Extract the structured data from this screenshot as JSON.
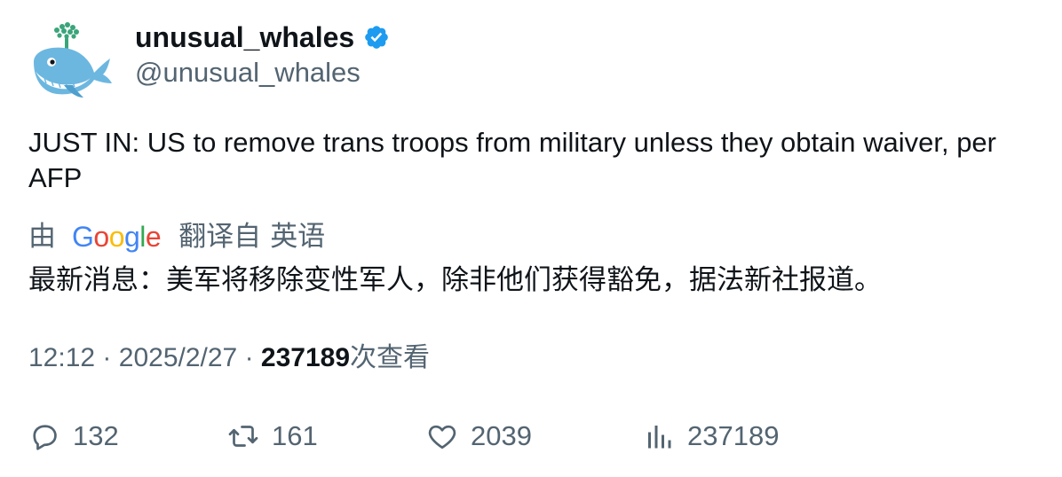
{
  "author": {
    "display_name": "unusual_whales",
    "handle": "@unusual_whales",
    "verified": true,
    "avatar_icon": "whale-logo-icon",
    "verified_color": "#1d9bf0"
  },
  "tweet": {
    "text": "JUST IN: US to remove trans troops from military unless they obtain waiver, per AFP"
  },
  "translation": {
    "by_label": "由",
    "provider": "Google",
    "translated_from_label": "翻译自",
    "language": "英语",
    "text": "最新消息：美军将移除变性军人，除非他们获得豁免，据法新社报道。"
  },
  "meta": {
    "time": "12:12",
    "separator": "·",
    "date": "2025/2/27",
    "views_count": "237189",
    "views_label": "次查看"
  },
  "actions": {
    "replies": "132",
    "retweets": "161",
    "likes": "2039",
    "views": "237189"
  },
  "colors": {
    "text_primary": "#0f1419",
    "text_secondary": "#536471",
    "google_blue": "#4285F4",
    "google_red": "#EA4335",
    "google_yellow": "#FBBC05",
    "google_green": "#34A853"
  }
}
